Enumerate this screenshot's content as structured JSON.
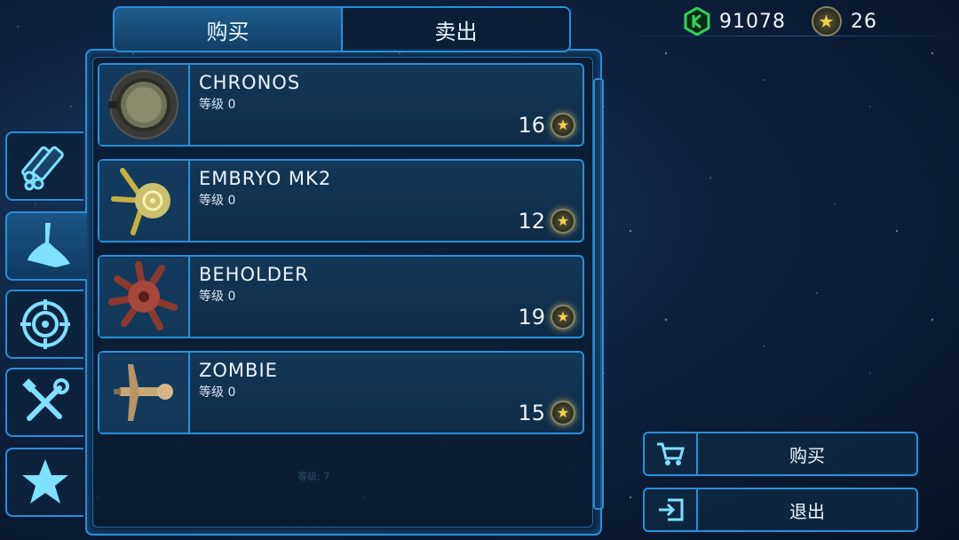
{
  "tabs": {
    "buy": "购买",
    "sell": "卖出"
  },
  "currency": {
    "gems": "91078",
    "stars": "26"
  },
  "side_tabs": [
    "weapons",
    "hooks",
    "targets",
    "tools",
    "favorites"
  ],
  "items": [
    {
      "name": "CHRONOS",
      "level_label": "等级",
      "level": "0",
      "price": "16"
    },
    {
      "name": "EMBRYO MK2",
      "level_label": "等级",
      "level": "0",
      "price": "12"
    },
    {
      "name": "BEHOLDER",
      "level_label": "等级",
      "level": "0",
      "price": "19"
    },
    {
      "name": "ZOMBIE",
      "level_label": "等级",
      "level": "0",
      "price": "15"
    }
  ],
  "actions": {
    "buy": "购买",
    "exit": "退出"
  },
  "colors": {
    "accent": "#2b8fd6",
    "gem": "#2fd45a",
    "star": "#f4d24a"
  }
}
